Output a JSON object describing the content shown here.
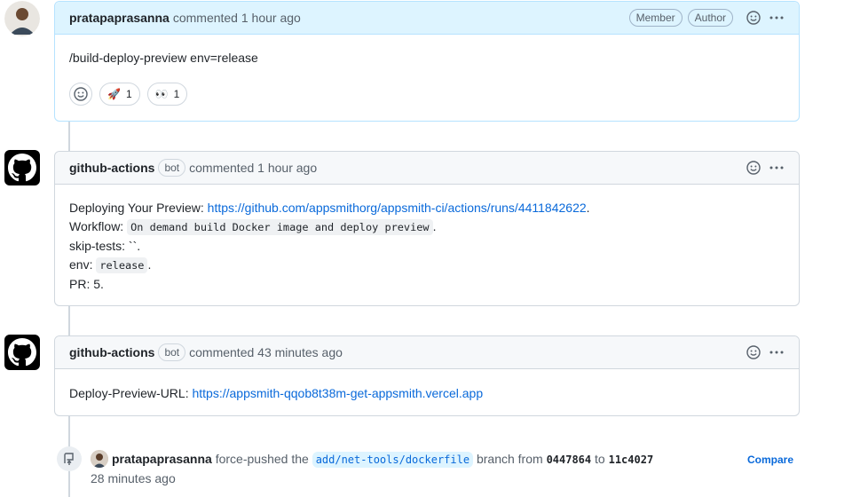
{
  "comments": [
    {
      "author": "pratapaprasanna",
      "meta": "commented 1 hour ago",
      "roles": [
        "Member",
        "Author"
      ],
      "body": "/build-deploy-preview env=release",
      "reactions": [
        {
          "emoji": "🚀",
          "count": "1"
        },
        {
          "emoji": "👀",
          "count": "1"
        }
      ]
    },
    {
      "author": "github-actions",
      "badge": "bot",
      "meta": "commented 1 hour ago",
      "lines": {
        "l1_prefix": "Deploying Your Preview: ",
        "l1_link": "https://github.com/appsmithorg/appsmith-ci/actions/runs/4411842622",
        "l1_suffix": ".",
        "l2_prefix": "Workflow: ",
        "l2_code": "On demand build Docker image and deploy preview",
        "l2_suffix": ".",
        "l3": "skip-tests: ``.",
        "l4_prefix": "env: ",
        "l4_code": "release",
        "l4_suffix": ".",
        "l5": "PR: 5."
      }
    },
    {
      "author": "github-actions",
      "badge": "bot",
      "meta": "commented 43 minutes ago",
      "body_prefix": "Deploy-Preview-URL: ",
      "body_link": "https://appsmith-qqob8t38m-get-appsmith.vercel.app"
    }
  ],
  "push_event": {
    "author": "pratapaprasanna",
    "text1": " force-pushed the ",
    "branch": "add/net-tools/dockerfile",
    "text2": " branch from ",
    "from_sha": "0447864",
    "text3": " to ",
    "to_sha": "11c4027",
    "time": "28 minutes ago",
    "compare_label": "Compare"
  },
  "icons": {
    "smiley": "smiley-icon",
    "kebab": "kebab-icon",
    "github": "github-logo-icon",
    "push": "repo-push-icon"
  }
}
